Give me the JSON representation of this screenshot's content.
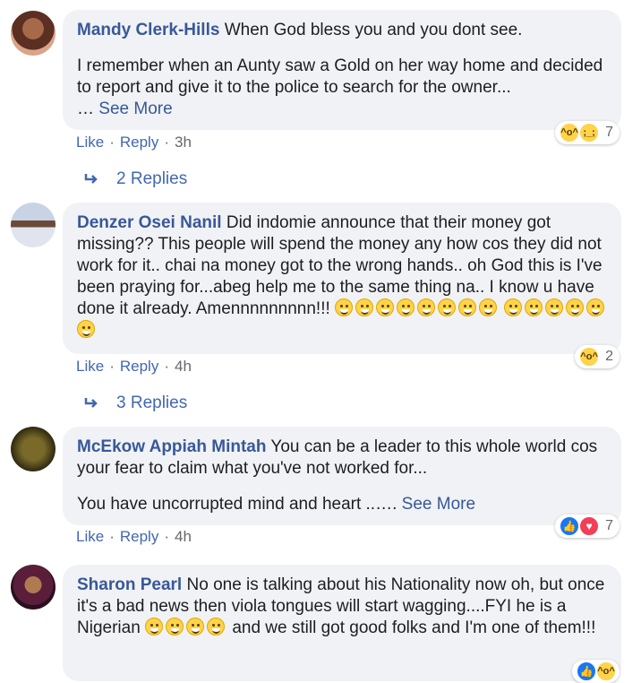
{
  "comments": [
    {
      "author": "Mandy Clerk-Hills",
      "text1": "When God bless you and you dont see.",
      "text2": "I remember when an Aunty saw a Gold on her way home and decided to report and give it to the police to search for the owner...",
      "see_more_prefix": "… ",
      "see_more": "See More",
      "like": "Like",
      "reply": "Reply",
      "time": "3h",
      "reaction_count": "7",
      "replies": "2 Replies"
    },
    {
      "author": "Denzer Osei Nanil",
      "text1": "Did indomie announce that their money got missing?? This people will spend the money any how cos they did not work for it.. chai na money got to the wrong hands.. oh God this is I've been praying for...abeg help me to the same thing na.. I know u have done it already. Amennnnnnnnn!!!",
      "like": "Like",
      "reply": "Reply",
      "time": "4h",
      "reaction_count": "2",
      "replies": "3 Replies"
    },
    {
      "author": "McEkow Appiah Mintah",
      "text1": "You can be a leader to this whole world cos your fear to claim what you've not worked for...",
      "text2": "You have uncorrupted mind and heart ..….",
      "see_more": "See More",
      "like": "Like",
      "reply": "Reply",
      "time": "4h",
      "reaction_count": "7"
    },
    {
      "author": "Sharon Pearl",
      "text1": "No one is talking about his Nationality now oh, but once it's a bad news then viola tongues will start wagging....FYI he is a Nigerian",
      "text2": "and we still got good folks and I'm one of them!!!"
    }
  ],
  "colors": {
    "link": "#385898",
    "bubble": "#f0f2f5",
    "meta": "#65676b"
  },
  "icons": [
    "haha-reaction-icon",
    "sad-reaction-icon",
    "like-reaction-icon",
    "love-reaction-icon",
    "reply-arrow-icon"
  ]
}
